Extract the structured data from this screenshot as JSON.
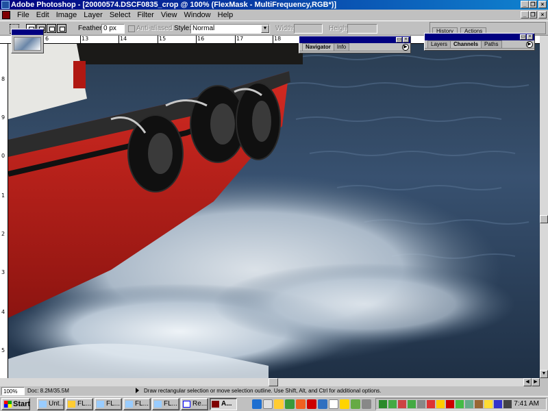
{
  "window": {
    "title": "Adobe Photoshop - [20000574.DSCF0835_crop @ 100% (FlexMask - MultiFrequency,RGB*)]"
  },
  "menubar": {
    "items": [
      {
        "label": "File"
      },
      {
        "label": "Edit"
      },
      {
        "label": "Image"
      },
      {
        "label": "Layer"
      },
      {
        "label": "Select"
      },
      {
        "label": "Filter"
      },
      {
        "label": "View"
      },
      {
        "label": "Window"
      },
      {
        "label": "Help"
      }
    ]
  },
  "options": {
    "feather_label": "Feather:",
    "feather_value": "0 px",
    "antialiased_label": "Anti-aliased",
    "style_label": "Style:",
    "style_value": "Normal",
    "width_label": "Width:",
    "height_label": "Height:"
  },
  "palette_well": {
    "tabs": [
      "History",
      "Actions"
    ]
  },
  "navigator_palette": {
    "tabs": [
      "Navigator",
      "Info"
    ],
    "active_tab": "Navigator"
  },
  "layers_palette": {
    "tabs": [
      "Layers",
      "Channels",
      "Paths"
    ],
    "active_tab": "Channels"
  },
  "rulers": {
    "top": [
      "6",
      "13",
      "14",
      "15",
      "16",
      "17",
      "18"
    ],
    "left": [
      "8",
      "9",
      "0",
      "1",
      "2",
      "3",
      "4",
      "5"
    ]
  },
  "statusbar": {
    "zoom": "100%",
    "doc_size": "Doc: 8.2M/35.5M",
    "hint": "Draw rectangular selection or move selection outline.  Use Shift, Alt, and Ctrl for additional options."
  },
  "taskbar": {
    "start_label": "Start",
    "tasks": [
      {
        "label": "Unt...",
        "icon": "explorer-icon"
      },
      {
        "label": "FL...",
        "icon": "folder-icon"
      },
      {
        "label": "FL...",
        "icon": "explorer-icon"
      },
      {
        "label": "FL...",
        "icon": "explorer-icon"
      },
      {
        "label": "FL...",
        "icon": "explorer-icon"
      },
      {
        "label": "Re...",
        "icon": "document-icon"
      },
      {
        "label": "A...",
        "icon": "photoshop-icon"
      }
    ],
    "clock": "7:41 AM"
  },
  "colors": {
    "title_start": "#000080",
    "title_end": "#1084d0",
    "hull_red": "#c8201c",
    "water": "#2f4560"
  }
}
